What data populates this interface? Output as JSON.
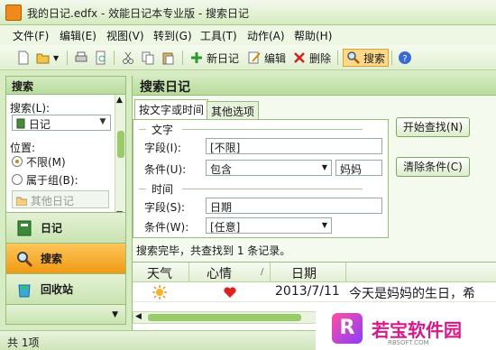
{
  "window": {
    "title": "我的日记.edfx - 效能日记本专业版 - 搜索日记"
  },
  "menu": [
    "文件(F)",
    "编辑(E)",
    "视图(V)",
    "转到(G)",
    "工具(T)",
    "动作(A)",
    "帮助(H)"
  ],
  "toolbar": {
    "new_diary": "新日记",
    "edit": "编辑",
    "delete": "删除",
    "search": "搜索"
  },
  "left_panel": {
    "header": "搜索",
    "search_label": "搜索(L):",
    "search_value": "日记",
    "position_label": "位置:",
    "radio_unlimited": "不限(M)",
    "radio_group": "属于组(B):",
    "group_item": "其他日记",
    "nav": [
      {
        "label": "日记",
        "icon": "diary-book-icon"
      },
      {
        "label": "搜索",
        "icon": "magnifier-icon"
      },
      {
        "label": "回收站",
        "icon": "recycle-bin-icon"
      }
    ]
  },
  "main": {
    "title": "搜索日记",
    "tabs": [
      "按文字或时间",
      "其他选项"
    ],
    "text_group": "文字",
    "field_label": "字段(I):",
    "field_value": "[不限]",
    "condition_label": "条件(U):",
    "condition_value": "包含",
    "keyword_value": "妈妈",
    "time_group": "时间",
    "time_field_label": "字段(S):",
    "time_field_value": "日期",
    "time_condition_label": "条件(W):",
    "time_condition_value": "[任意]",
    "start_button": "开始查找(N)",
    "clear_button": "清除条件(C)",
    "result_text": "搜索完毕，共查找到 1 条记录。",
    "columns": [
      "天气",
      "心情",
      "/",
      "日期"
    ],
    "rows": [
      {
        "weather_icon": "sun-icon",
        "mood_icon": "heart-icon",
        "date": "2013/7/11",
        "text": "今天是妈妈的生日，希"
      }
    ]
  },
  "status": {
    "text": "共 1项"
  },
  "watermark": {
    "text": "若宝软件园",
    "sub": "RBSOFT.COM"
  },
  "colors": {
    "accent": "#f09a14",
    "panel": "#b9dc9d",
    "heart": "#e02020"
  }
}
